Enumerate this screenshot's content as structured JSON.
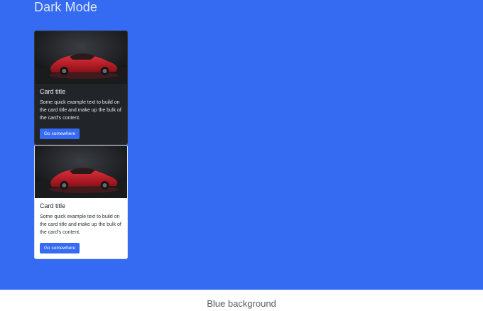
{
  "page": {
    "heading": "Dark Mode",
    "caption": "Blue background"
  },
  "cards": [
    {
      "theme": "dark",
      "image": "red-sports-car",
      "title": "Card title",
      "text": "Some quick example text to build on the card title and make up the bulk of the card's content.",
      "button_label": "Go somewhere"
    },
    {
      "theme": "light",
      "image": "red-sports-car",
      "title": "Card title",
      "text": "Some quick example text to build on the card title and make up the bulk of the card's content.",
      "button_label": "Go somewhere"
    }
  ],
  "colors": {
    "background": "#356bf2",
    "button": "#356bf2",
    "dark_card": "#212429",
    "light_card": "#ffffff"
  }
}
